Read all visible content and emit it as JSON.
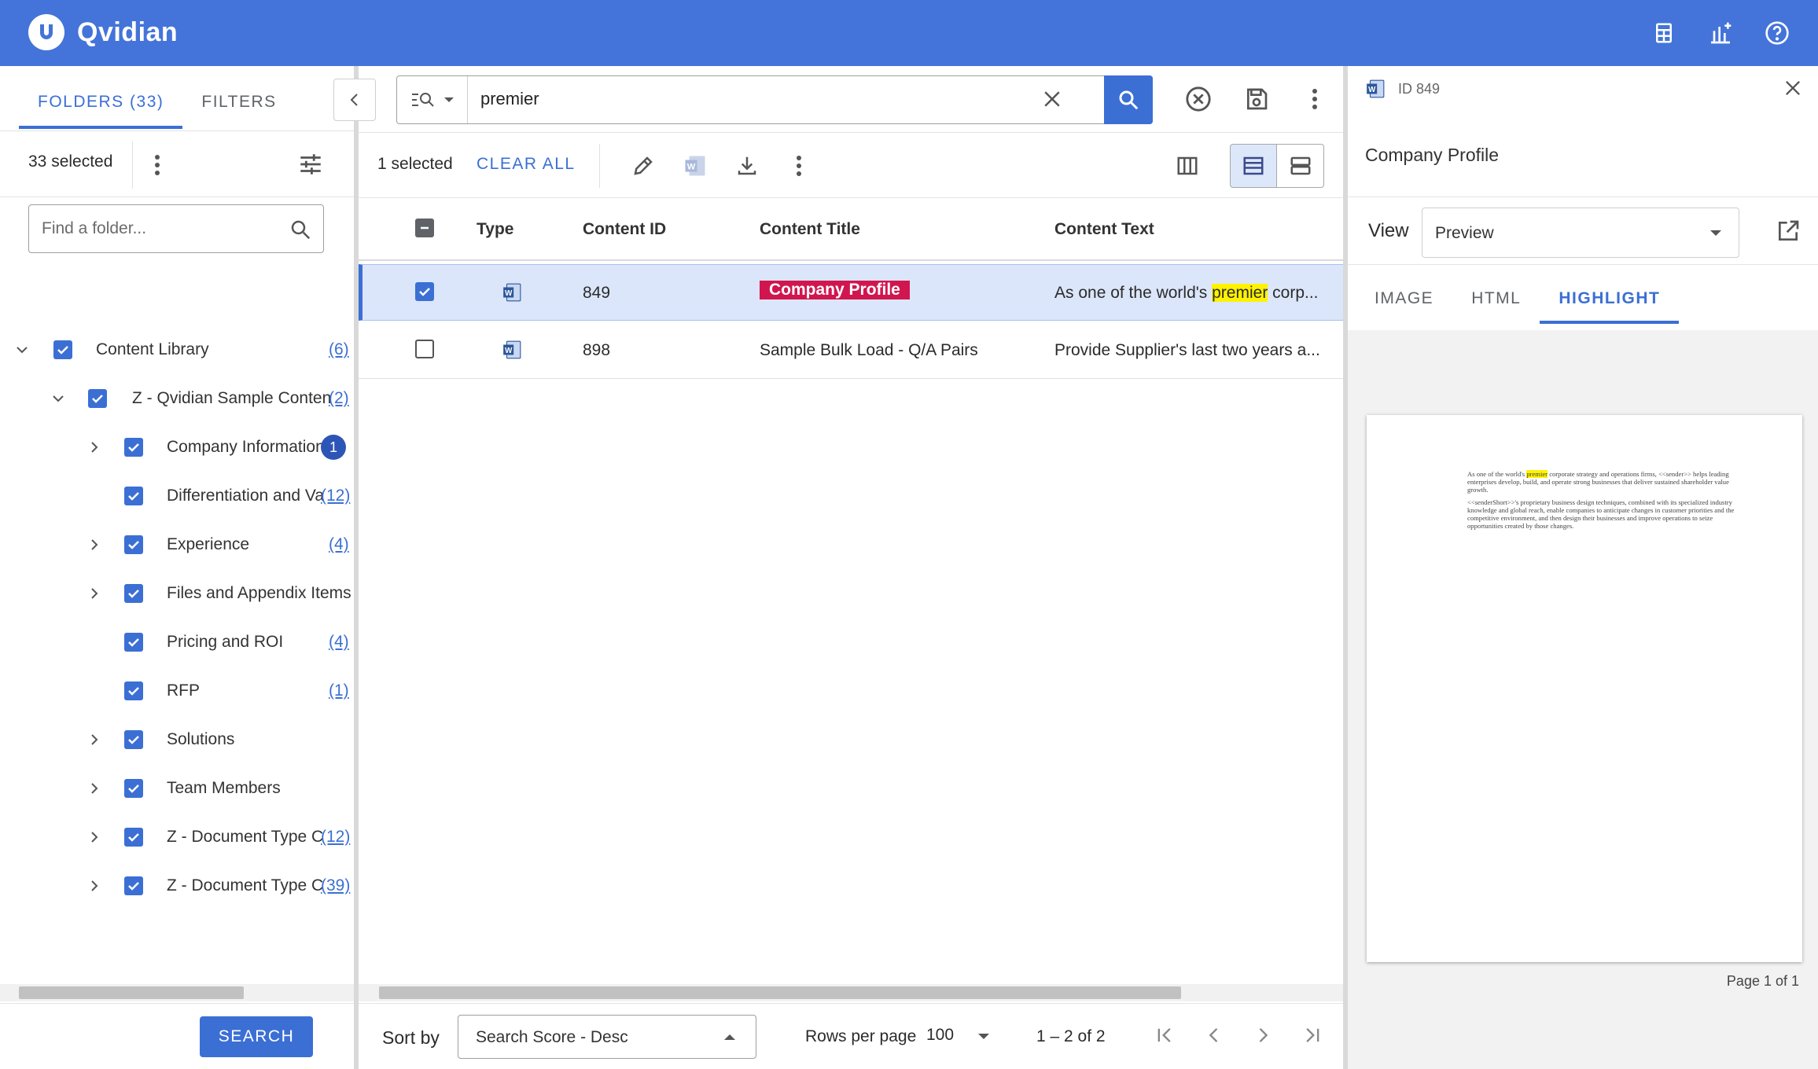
{
  "app": {
    "name": "Qvidian"
  },
  "header": {
    "icons": [
      "calculator-icon",
      "insights-icon",
      "help-icon"
    ]
  },
  "left": {
    "tabs": [
      {
        "label": "FOLDERS (33)"
      },
      {
        "label": "FILTERS"
      }
    ],
    "selected_count": "33 selected",
    "folder_search": {
      "placeholder": "Find a folder..."
    },
    "tree": [
      {
        "label": "Content Library",
        "count": "(6)"
      },
      {
        "label": "Z - Qvidian Sample Content",
        "count": "(2)"
      },
      {
        "label": "Company Information",
        "badge": "1"
      },
      {
        "label": "Differentiation and Value",
        "count": "(12)"
      },
      {
        "label": "Experience",
        "count": "(4)"
      },
      {
        "label": "Files and Appendix Items",
        "count": ""
      },
      {
        "label": "Pricing and ROI",
        "count": "(4)"
      },
      {
        "label": "RFP",
        "count": "(1)"
      },
      {
        "label": "Solutions",
        "count": ""
      },
      {
        "label": "Team Members",
        "count": ""
      },
      {
        "label": "Z - Document Type Content",
        "count": "(12)"
      },
      {
        "label": "Z - Document Type Content",
        "count": "(39)"
      }
    ],
    "search_button": "SEARCH"
  },
  "search": {
    "value": "premier"
  },
  "toolbar": {
    "selected": "1 selected",
    "clear_all": "CLEAR ALL"
  },
  "table": {
    "columns": [
      "Type",
      "Content ID",
      "Content Title",
      "Content Text"
    ],
    "rows": [
      {
        "id": "849",
        "title": "Company Profile",
        "text_before": "As one of the world's ",
        "text_highlight": "premier",
        "text_after": " corp...",
        "selected": true
      },
      {
        "id": "898",
        "title": "Sample Bulk Load - Q/A Pairs",
        "text": "Provide Supplier's last two years a...",
        "selected": false
      }
    ]
  },
  "footer": {
    "sort_by_label": "Sort by",
    "sort_value": "Search Score - Desc",
    "rows_per_page_label": "Rows per page",
    "rows_per_page_value": "100",
    "range": "1 – 2 of 2"
  },
  "preview": {
    "id_label": "ID 849",
    "title": "Company Profile",
    "view_label": "View",
    "view_value": "Preview",
    "tabs": [
      "IMAGE",
      "HTML",
      "HIGHLIGHT"
    ],
    "doc_p1_before": "As one of the world's ",
    "doc_p1_highlight": "premier",
    "doc_p1_after": " corporate strategy and operations firms, <<sender>> helps leading enterprises develop, build, and operate strong businesses that deliver sustained shareholder value growth.",
    "doc_p2": "<<senderShort>>'s proprietary business design techniques, combined with its specialized industry knowledge and global reach, enable companies to anticipate changes in customer priorities and the competitive environment, and then design their businesses and improve operations to seize opportunities created by those changes.",
    "page_number": "Page 1 of 1"
  }
}
